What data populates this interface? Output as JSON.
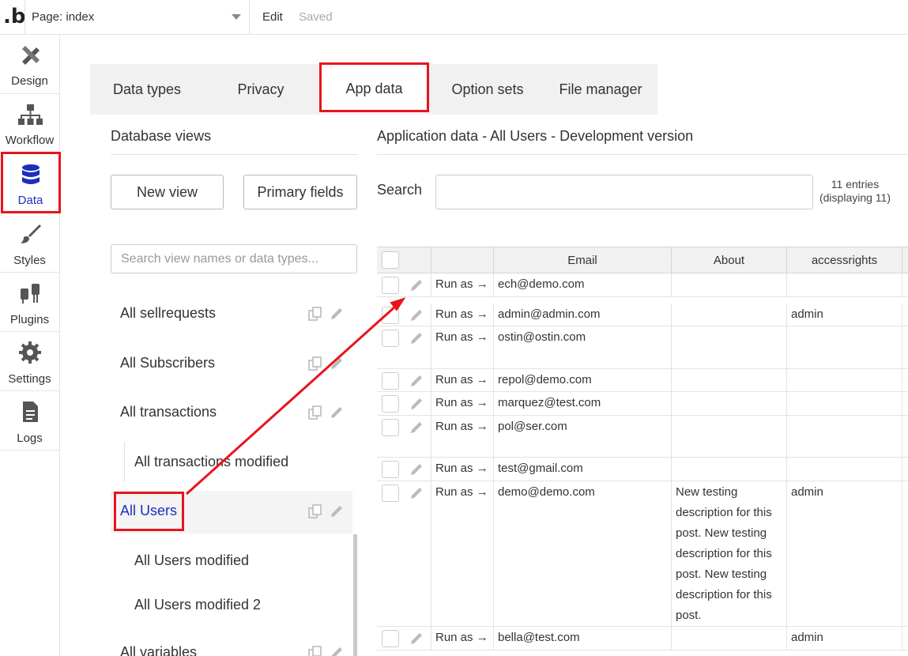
{
  "topbar": {
    "page_label": "Page: index",
    "edit": "Edit",
    "saved": "Saved"
  },
  "nav": [
    {
      "label": "Design",
      "icon": "design-icon"
    },
    {
      "label": "Workflow",
      "icon": "workflow-icon"
    },
    {
      "label": "Data",
      "icon": "database-icon"
    },
    {
      "label": "Styles",
      "icon": "brush-icon"
    },
    {
      "label": "Plugins",
      "icon": "plug-icon"
    },
    {
      "label": "Settings",
      "icon": "gear-icon"
    },
    {
      "label": "Logs",
      "icon": "document-icon"
    }
  ],
  "tabs": [
    "Data types",
    "Privacy",
    "App data",
    "Option sets",
    "File manager"
  ],
  "left": {
    "title": "Database views",
    "new_view": "New view",
    "primary_fields": "Primary fields",
    "search_placeholder": "Search view names or data types...",
    "views": [
      "All sellrequests",
      "All Subscribers",
      "All transactions",
      "All transactions modified",
      "All Users",
      "All Users modified",
      "All Users modified 2",
      "All variables"
    ]
  },
  "right": {
    "title": "Application data - All Users - Development version",
    "search_label": "Search",
    "entries_line1": "11 entries",
    "entries_line2": "(displaying 11)",
    "columns": [
      "Email",
      "About",
      "accessrights"
    ],
    "run_as": "Run as →",
    "rows": [
      {
        "email": "ech@demo.com",
        "about": "",
        "access": ""
      },
      {
        "email": "admin@admin.com",
        "about": "",
        "access": "admin"
      },
      {
        "email": "ostin@ostin.com",
        "about": "",
        "access": ""
      },
      {
        "email": "repol@demo.com",
        "about": "",
        "access": ""
      },
      {
        "email": "marquez@test.com",
        "about": "",
        "access": ""
      },
      {
        "email": "pol@ser.com",
        "about": "",
        "access": ""
      },
      {
        "email": "test@gmail.com",
        "about": "",
        "access": ""
      },
      {
        "email": "demo@demo.com",
        "about": "New testing description for this post. New testing description for this post. New testing description for this post.",
        "access": "admin"
      },
      {
        "email": "bella@test.com",
        "about": "",
        "access": "admin"
      }
    ]
  },
  "colors": {
    "accent_red": "#e8141c",
    "link_blue": "#1c2fbc"
  }
}
